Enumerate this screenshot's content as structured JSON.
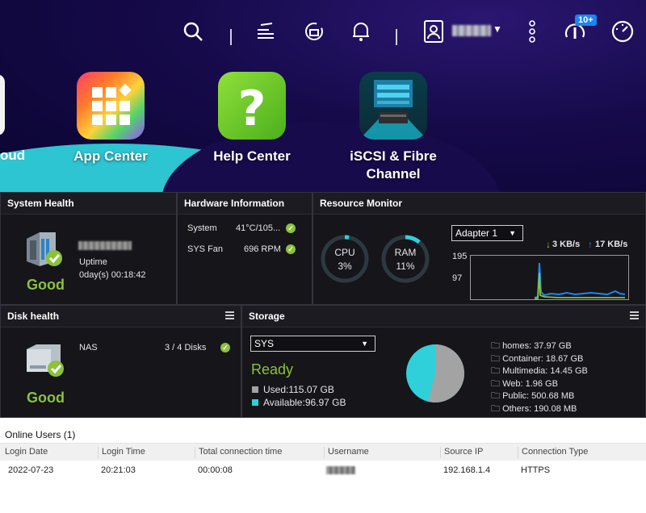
{
  "topbar": {
    "icons": [
      "search-icon",
      "tasks-icon",
      "sync-icon",
      "bell-icon",
      "user-icon",
      "more-icon",
      "info-icon",
      "dashboard-icon"
    ],
    "notification_badge": "10+"
  },
  "apps": [
    {
      "label": "oud"
    },
    {
      "label": "App Center"
    },
    {
      "label": "Help Center"
    },
    {
      "label": "iSCSI & Fibre Channel"
    }
  ],
  "system_health": {
    "title": "System Health",
    "uptime_label": "Uptime",
    "uptime_value": "0day(s) 00:18:42",
    "status": "Good"
  },
  "hardware": {
    "title": "Hardware Information",
    "rows": [
      {
        "label": "System",
        "value": "41°C/105..."
      },
      {
        "label": "SYS Fan",
        "value": "696 RPM"
      }
    ]
  },
  "resource_monitor": {
    "title": "Resource Monitor",
    "cpu_label": "CPU",
    "cpu_value": "3%",
    "cpu_fraction": 0.03,
    "ram_label": "RAM",
    "ram_value": "11%",
    "ram_fraction": 0.11,
    "adapter": "Adapter 1",
    "download": "3 KB/s",
    "upload": "17 KB/s",
    "y_ticks": [
      "195",
      "97"
    ]
  },
  "disk_health": {
    "title": "Disk health",
    "nas_label": "NAS",
    "disks": "3 / 4 Disks",
    "status": "Good"
  },
  "storage": {
    "title": "Storage",
    "volume": "SYS",
    "status": "Ready",
    "used": "Used:115.07 GB",
    "available": "Available:96.97 GB",
    "used_fraction": 0.54,
    "folders": [
      "homes: 37.97 GB",
      "Container: 18.67 GB",
      "Multimedia: 14.45 GB",
      "Web: 1.96 GB",
      "Public: 500.68 MB",
      "Others: 190.08 MB"
    ]
  },
  "online_users": {
    "title": "Online Users (1)",
    "columns": [
      "Login Date",
      "Login Time",
      "Total connection time",
      "Username",
      "Source IP",
      "Connection Type"
    ],
    "row": [
      "2022-07-23",
      "20:21:03",
      "00:00:08",
      "",
      "192.168.1.4",
      "HTTPS"
    ]
  },
  "colors": {
    "good": "#8bc23a",
    "accent_cyan": "#2fd0da",
    "badge_blue": "#1b86f0",
    "used_gray": "#a3a3a3"
  }
}
